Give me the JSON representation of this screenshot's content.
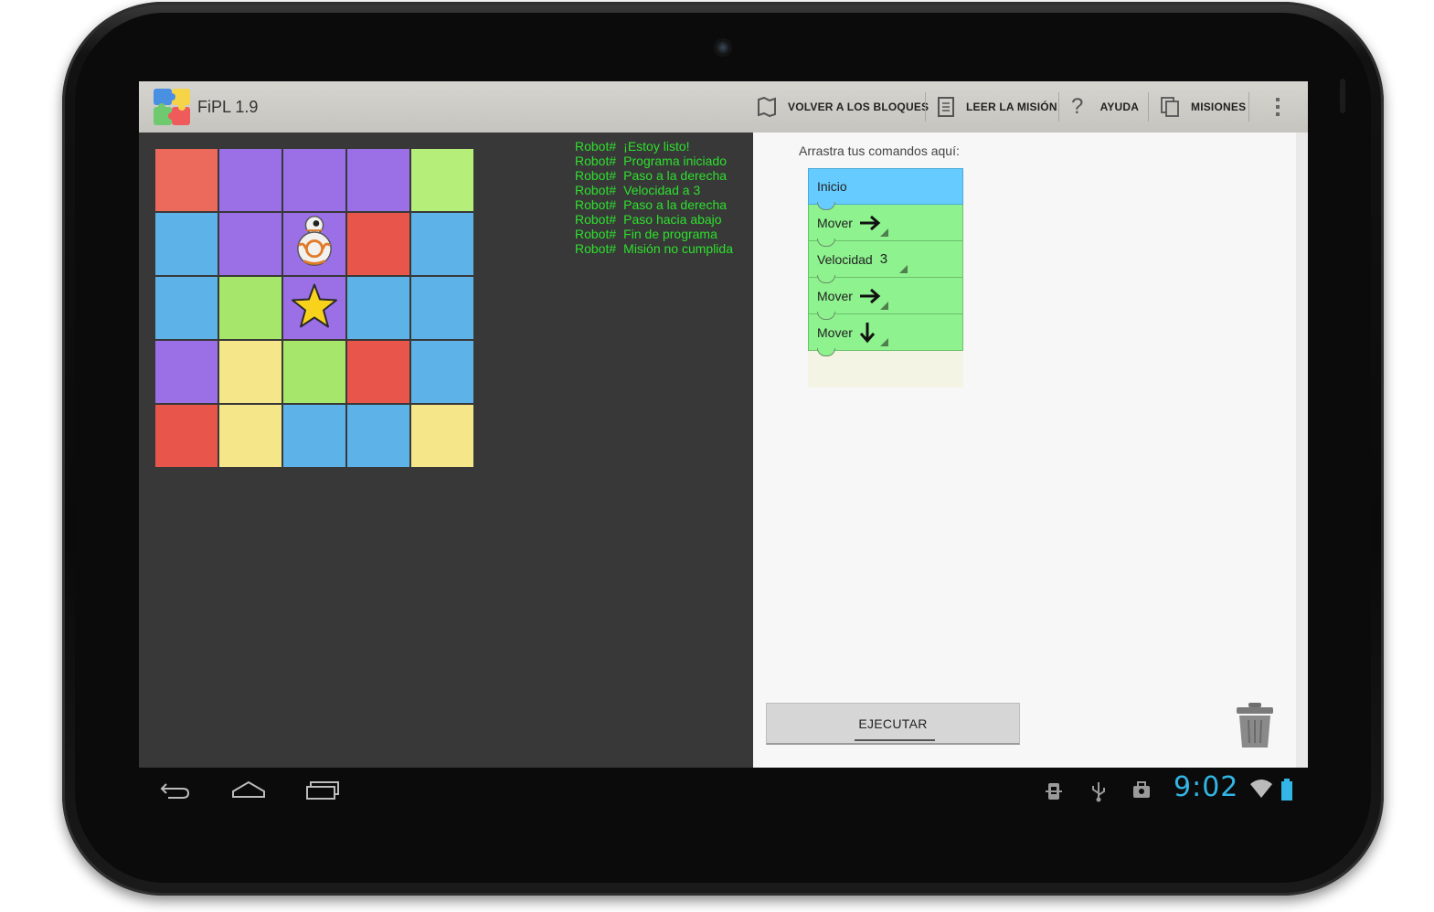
{
  "app": {
    "title": "FiPL 1.9"
  },
  "actionbar": {
    "items": [
      {
        "label": "VOLVER A LOS BLOQUES",
        "icon": "map-icon"
      },
      {
        "label": "LEER LA MISIÓN",
        "icon": "document-icon"
      },
      {
        "label": "AYUDA",
        "icon": "help-icon"
      },
      {
        "label": "MISIONES",
        "icon": "copy-icon"
      }
    ],
    "overflow_icon": "overflow-menu-icon"
  },
  "board": {
    "rows": [
      [
        "#eb6a5c",
        "#9b6fe6",
        "#9b6fe6",
        "#9b6fe6",
        "#b5ef7a"
      ],
      [
        "#5db3e8",
        "#9b6fe6",
        "#9b6fe6",
        "#e8554a",
        "#5db3e8"
      ],
      [
        "#5db3e8",
        "#a6e66a",
        "#9b6fe6",
        "#5db3e8",
        "#5db3e8"
      ],
      [
        "#9b6fe6",
        "#f5e68a",
        "#a6e66a",
        "#e8554a",
        "#5db3e8"
      ],
      [
        "#e8554a",
        "#f5e68a",
        "#5db3e8",
        "#5db3e8",
        "#f5e68a"
      ]
    ],
    "robot": {
      "row": 1,
      "col": 2,
      "icon": "robot-icon"
    },
    "goal": {
      "row": 2,
      "col": 2,
      "icon": "star-icon"
    }
  },
  "log": {
    "prefix": "Robot#",
    "lines": [
      "¡Estoy listo!",
      "Programa iniciado",
      "Paso a la derecha",
      "Velocidad a 3",
      "Paso a la derecha",
      "Paso hacia abajo",
      "Fin de programa",
      "Misión no cumplida"
    ]
  },
  "program": {
    "hint": "Arrastra tus comandos aquí:",
    "blocks": [
      {
        "label": "Inicio",
        "kind": "start"
      },
      {
        "label": "Mover",
        "kind": "move",
        "param": "arrow-right-icon"
      },
      {
        "label": "Velocidad",
        "kind": "speed",
        "param": "3"
      },
      {
        "label": "Mover",
        "kind": "move",
        "param": "arrow-right-icon"
      },
      {
        "label": "Mover",
        "kind": "move",
        "param": "arrow-down-icon"
      }
    ]
  },
  "controls": {
    "run_label": "EJECUTAR",
    "trash_icon": "trash-icon"
  },
  "navbar": {
    "back_icon": "back-icon",
    "home_icon": "home-icon",
    "recents_icon": "recent-apps-icon"
  },
  "status": {
    "time": "9:02",
    "icons": [
      "debug-icon",
      "usb-icon",
      "briefcase-icon",
      "wifi-icon",
      "battery-icon"
    ]
  },
  "colors": {
    "log_text": "#2de02d",
    "clock": "#33b5e5",
    "start_block": "#66ccff",
    "command_block": "#8ef28e"
  }
}
